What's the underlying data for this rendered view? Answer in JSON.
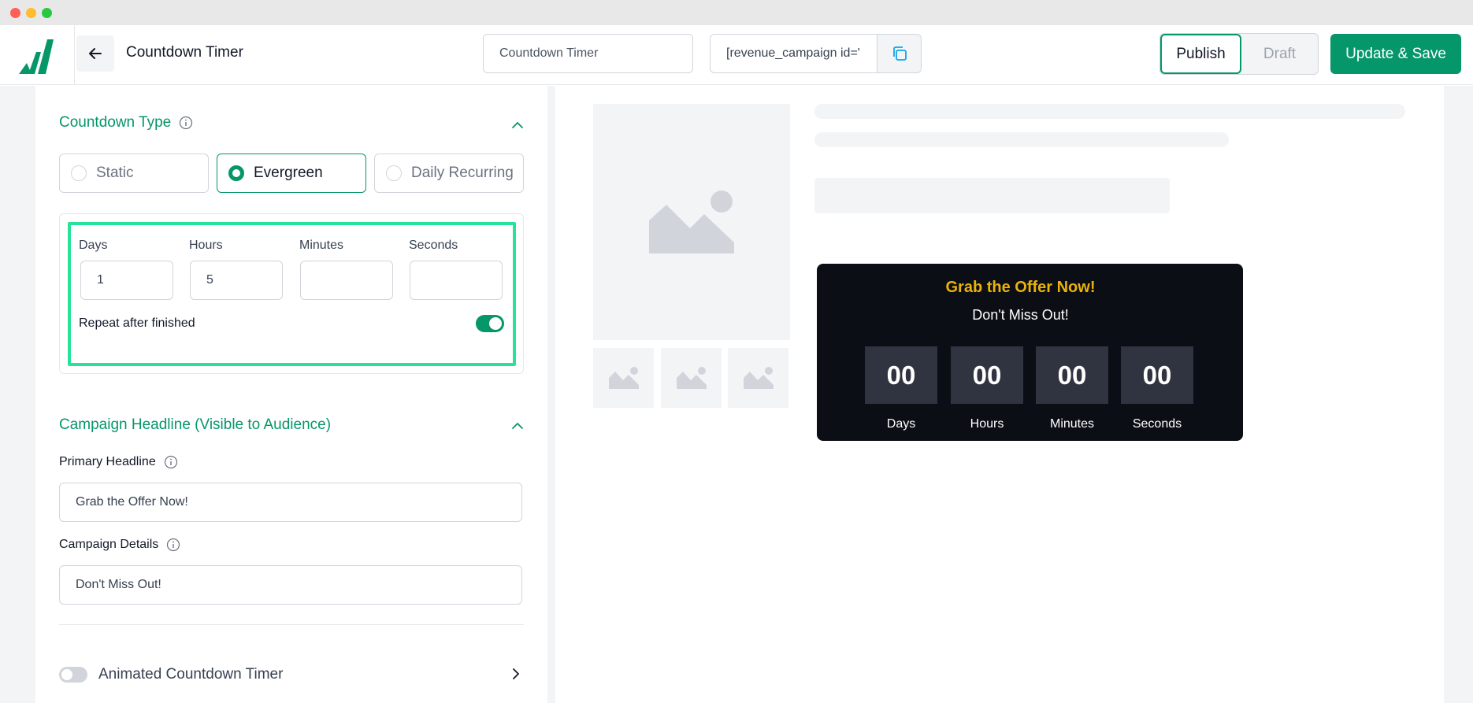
{
  "header": {
    "page_title": "Countdown Timer",
    "campaign_name_value": "Countdown Timer",
    "shortcode_text": "[revenue_campaign id='",
    "publish_label": "Publish",
    "draft_label": "Draft",
    "save_label": "Update & Save"
  },
  "countdown_type": {
    "title": "Countdown Type",
    "options": [
      {
        "label": "Static",
        "selected": false
      },
      {
        "label": "Evergreen",
        "selected": true
      },
      {
        "label": "Daily Recurring",
        "selected": false
      }
    ]
  },
  "timer": {
    "days_label": "Days",
    "hours_label": "Hours",
    "minutes_label": "Minutes",
    "seconds_label": "Seconds",
    "days_value": "1",
    "hours_value": "5",
    "minutes_value": "",
    "seconds_value": "",
    "repeat_label": "Repeat after finished",
    "repeat_enabled": true
  },
  "headline_section": {
    "title": "Campaign Headline (Visible to Audience)",
    "primary_label": "Primary Headline",
    "primary_value": "Grab the Offer Now!",
    "details_label": "Campaign Details",
    "details_value": "Don't Miss Out!"
  },
  "animated": {
    "label": "Animated Countdown Timer",
    "enabled": false
  },
  "preview": {
    "headline": "Grab the Offer Now!",
    "details": "Don't Miss Out!",
    "units": [
      {
        "value": "00",
        "label": "Days"
      },
      {
        "value": "00",
        "label": "Hours"
      },
      {
        "value": "00",
        "label": "Minutes"
      },
      {
        "value": "00",
        "label": "Seconds"
      }
    ]
  },
  "colors": {
    "accent": "#059669",
    "highlight": "#27e39a",
    "headline_yellow": "#eab308",
    "timer_bg": "#0b0e14"
  }
}
